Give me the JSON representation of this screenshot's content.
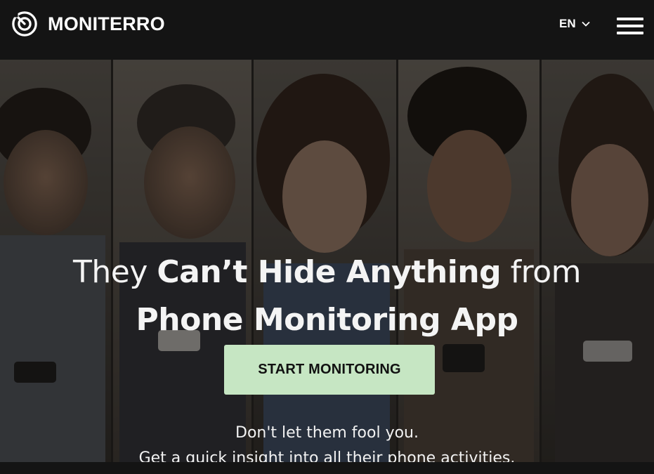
{
  "brand": {
    "name": "MONITERRO",
    "logo_icon": "radar-icon"
  },
  "header": {
    "language": "EN",
    "language_icon": "chevron-down-icon",
    "menu_icon": "hamburger-menu-icon"
  },
  "hero": {
    "headline": {
      "part1": "They ",
      "part2_bold": "Can’t Hide Anything",
      "part3": " from",
      "line2_bold": "Phone Monitoring App"
    },
    "cta_label": "START MONITORING",
    "subtext": {
      "line1": "Don't let them fool you.",
      "line2": "Get a quick insight into all their phone activities."
    }
  },
  "colors": {
    "header_bg": "#141414",
    "cta_bg": "#c6e6c3",
    "text_light": "#f4f4f4"
  }
}
